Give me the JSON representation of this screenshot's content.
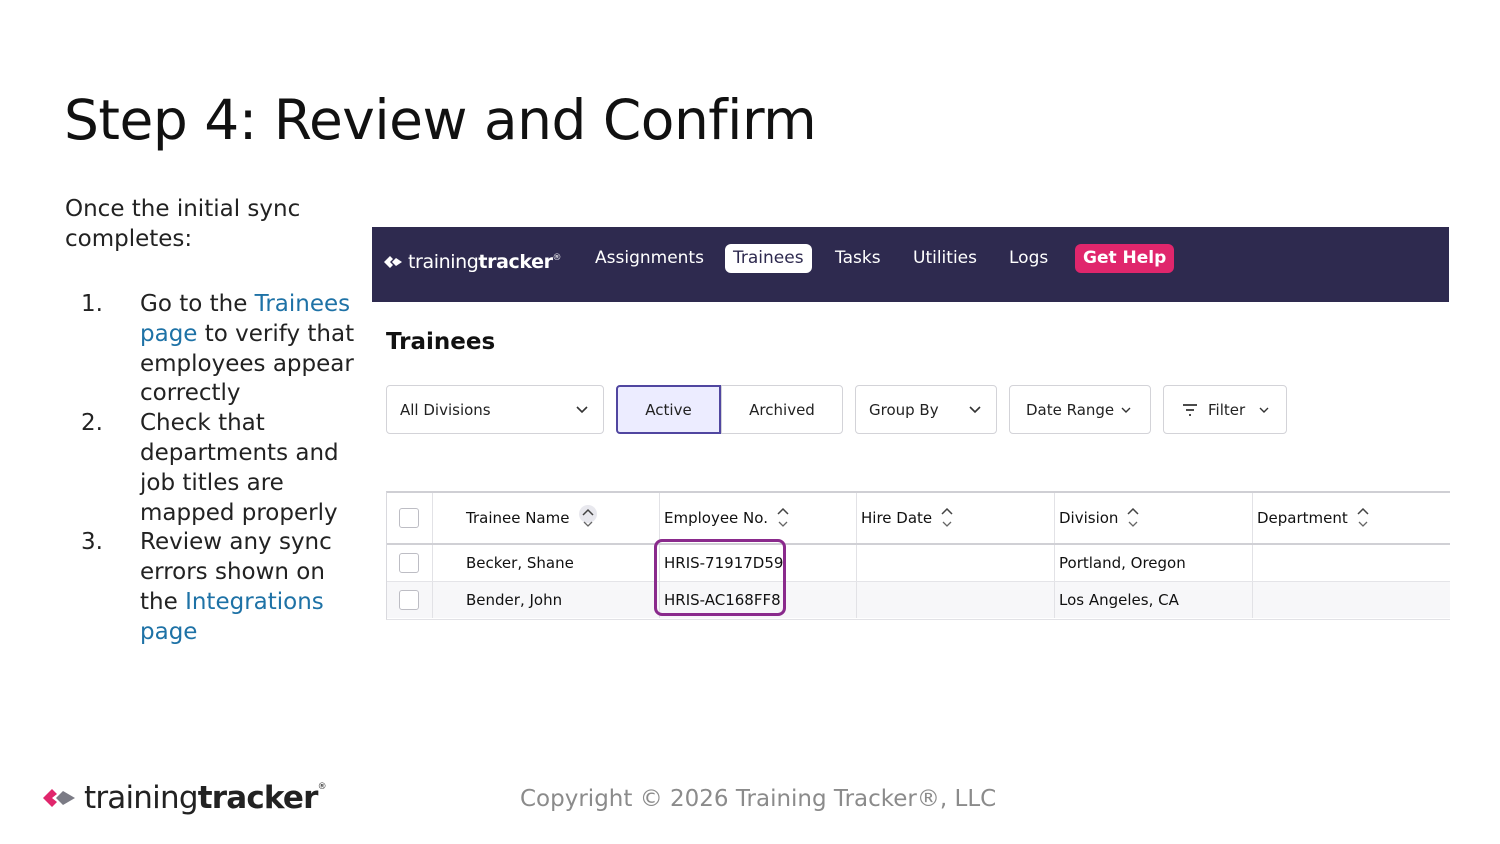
{
  "slide": {
    "title": "Step 4: Review and Confirm",
    "intro": "Once the initial sync completes:",
    "steps": [
      {
        "num": "1.",
        "pre": "Go to the ",
        "link": "Trainees page",
        "post": " to verify that employees appear correctly"
      },
      {
        "num": "2.",
        "pre": "Check that departments and job titles are mapped properly",
        "link": "",
        "post": ""
      },
      {
        "num": "3.",
        "pre": "Review any sync errors shown on the ",
        "link": "Integrations page",
        "post": ""
      }
    ]
  },
  "app": {
    "logo": {
      "light": "training",
      "bold": "tracker",
      "reg": "®"
    },
    "nav": [
      {
        "label": "Assignments",
        "active": false
      },
      {
        "label": "Trainees",
        "active": true
      },
      {
        "label": "Tasks",
        "active": false
      },
      {
        "label": "Utilities",
        "active": false
      },
      {
        "label": "Logs",
        "active": false
      },
      {
        "label": "Get Help",
        "active": false
      }
    ],
    "page_title": "Trainees",
    "filters": {
      "division": "All Divisions",
      "status_active": "Active",
      "status_archived": "Archived",
      "group_by": "Group By",
      "date_range": "Date Range",
      "filter": "Filter"
    },
    "table": {
      "columns": [
        "Trainee Name",
        "Employee No.",
        "Hire Date",
        "Division",
        "Department"
      ],
      "rows": [
        {
          "name": "Becker, Shane",
          "employee_no": "HRIS-71917D59",
          "hire_date": "",
          "division": "Portland, Oregon",
          "department": ""
        },
        {
          "name": "Bender, John",
          "employee_no": "HRIS-AC168FF8",
          "hire_date": "",
          "division": "Los Angeles, CA",
          "department": ""
        }
      ]
    }
  },
  "footer": {
    "logo": {
      "light": "training",
      "bold": "tracker",
      "reg": "®"
    },
    "copyright": "Copyright © 2026 Training Tracker®, LLC"
  },
  "colors": {
    "navbar": "#2e2a4f",
    "get_help": "#e0266c",
    "link": "#1e72a6",
    "highlight": "#8a2a8c",
    "active_segment": "#ececff"
  },
  "icons": [
    "brand-logo-icon",
    "chevron-down-icon",
    "sort-icon",
    "filter-icon",
    "checkbox-icon"
  ]
}
